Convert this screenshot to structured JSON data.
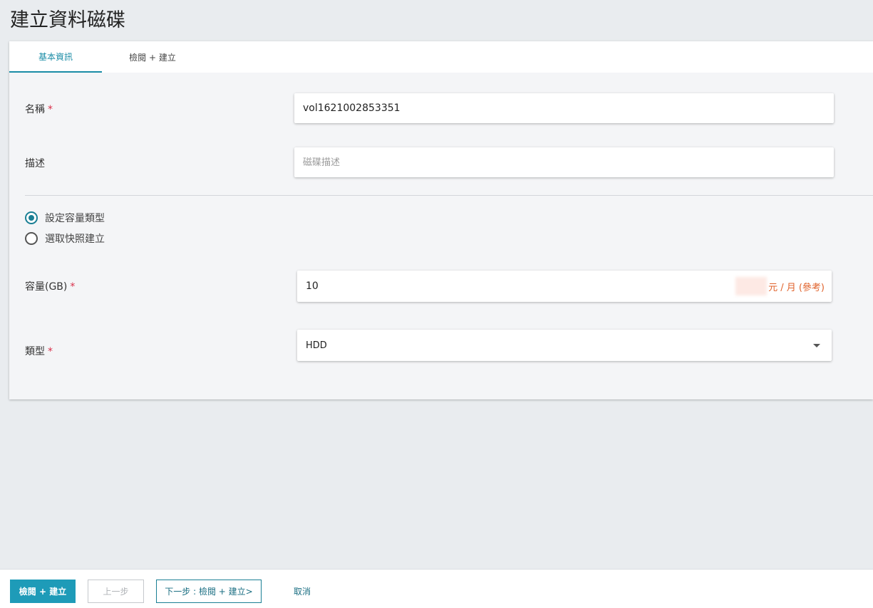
{
  "page": {
    "title": "建立資料磁碟"
  },
  "tabs": [
    {
      "label": "基本資訊",
      "active": true
    },
    {
      "label": "檢閱 + 建立",
      "active": false
    }
  ],
  "form": {
    "name": {
      "label": "名稱",
      "required_mark": "*",
      "value": "vol1621002853351"
    },
    "description": {
      "label": "描述",
      "placeholder": "磁碟描述",
      "value": ""
    },
    "source_options": [
      {
        "label": "設定容量類型",
        "checked": true
      },
      {
        "label": "選取快照建立",
        "checked": false
      }
    ],
    "capacity": {
      "label": "容量(GB)",
      "required_mark": "*",
      "value": "10",
      "price_suffix": "元 / 月 (參考)"
    },
    "type": {
      "label": "類型",
      "required_mark": "*",
      "value": "HDD"
    }
  },
  "footer": {
    "review_create": "檢閱 + 建立",
    "previous": "上一步",
    "next": "下一步 : 檢閱 + 建立>",
    "cancel": "取消"
  },
  "colors": {
    "accent": "#1a8ca6",
    "primary_button": "#1e9bb8",
    "required": "#d9304a",
    "price": "#e0622b"
  }
}
